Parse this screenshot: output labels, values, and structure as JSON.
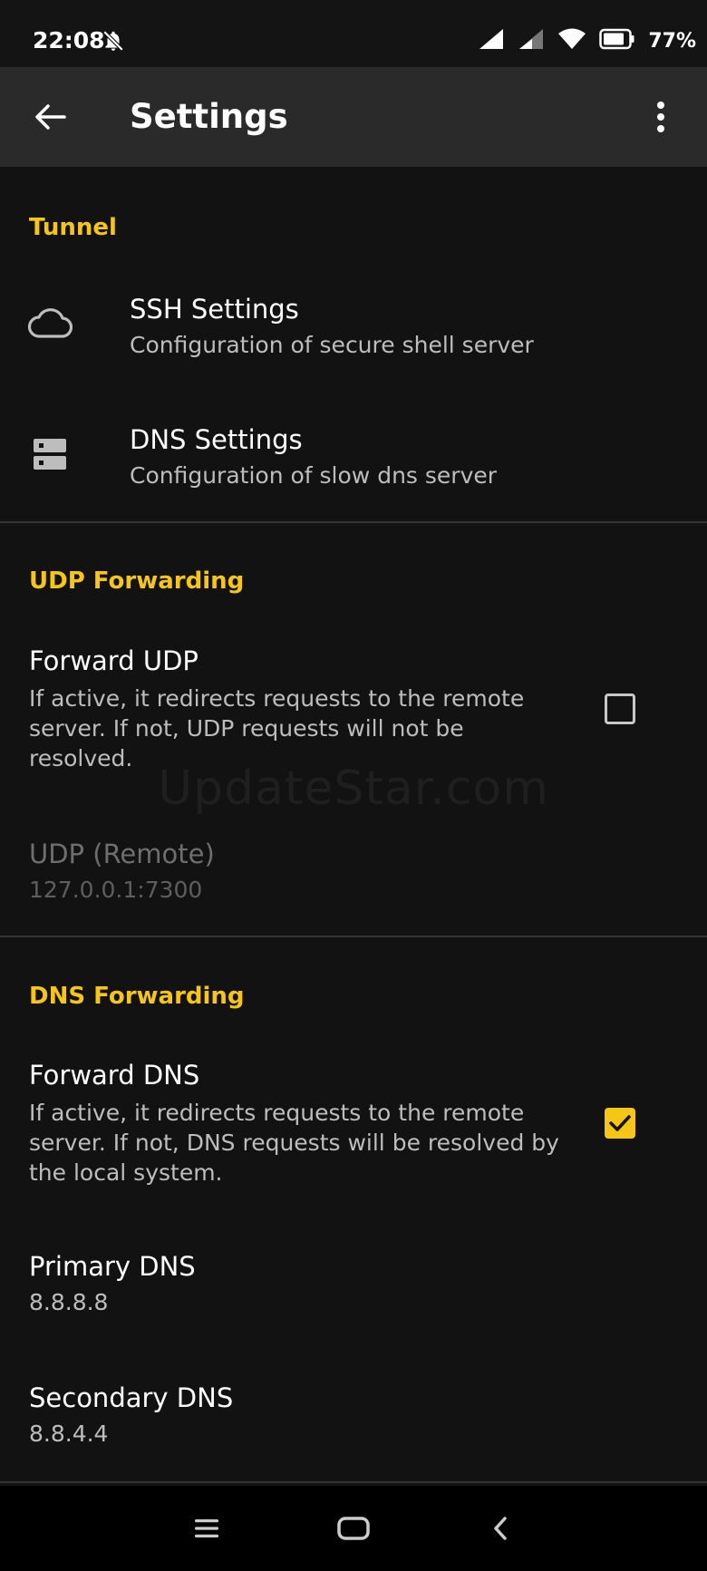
{
  "status_bar": {
    "time": "22:08",
    "battery": "77%"
  },
  "toolbar": {
    "title": "Settings"
  },
  "sections": {
    "tunnel": {
      "header": "Tunnel",
      "ssh": {
        "title": "SSH Settings",
        "subtitle": "Configuration of secure shell server",
        "icon": "cloud-icon"
      },
      "dns": {
        "title": "DNS Settings",
        "subtitle": "Configuration of slow dns server",
        "icon": "dns-server-icon"
      }
    },
    "udp_forwarding": {
      "header": "UDP Forwarding",
      "forward_udp": {
        "title": "Forward UDP",
        "subtitle_line1": "If active, it redirects requests to the remote",
        "subtitle_line2": "server. If not, UDP requests will not be",
        "subtitle_line3": "resolved.",
        "checked": false
      },
      "udp_remote": {
        "title": "UDP (Remote)",
        "value": "127.0.0.1:7300"
      }
    },
    "dns_forwarding": {
      "header": "DNS Forwarding",
      "forward_dns": {
        "title": "Forward DNS",
        "subtitle_line1": "If active, it redirects requests to the remote",
        "subtitle_line2": "server. If not, DNS requests will be resolved by",
        "subtitle_line3": "the local system.",
        "checked": true
      },
      "primary_dns": {
        "title": "Primary DNS",
        "value": "8.8.8.8"
      },
      "secondary_dns": {
        "title": "Secondary DNS",
        "value": "8.8.4.4"
      }
    }
  },
  "watermark": "UpdateStar.com",
  "colors": {
    "accent": "#f5c518",
    "background": "#121212",
    "toolbar": "#2a2a2a"
  }
}
